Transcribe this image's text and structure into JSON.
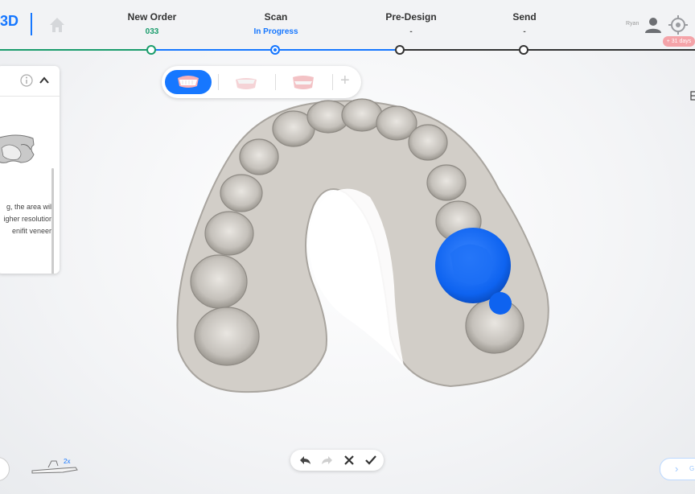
{
  "header": {
    "logo": "3D",
    "steps": [
      {
        "title": "New Order",
        "sub": "033",
        "state": "done"
      },
      {
        "title": "Scan",
        "sub": "In Progress",
        "state": "current"
      },
      {
        "title": "Pre-Design",
        "sub": "-",
        "state": "pending"
      },
      {
        "title": "Send",
        "sub": "-",
        "state": "pending"
      }
    ],
    "user_name": "Ryan",
    "days_badge": "+ 31 days"
  },
  "left_panel": {
    "text_lines": [
      "g, the area will",
      "igher resolution",
      "enifit veneer,"
    ]
  },
  "jaw_selector": {
    "options": [
      "upper-jaw",
      "lower-jaw",
      "bite"
    ],
    "selected": "upper-jaw",
    "add_label": "+"
  },
  "scanner": {
    "label": "2x"
  },
  "actions": [
    "undo",
    "redo",
    "cancel",
    "confirm"
  ],
  "next_button": {
    "label": "G"
  },
  "colors": {
    "accent": "#1677ff",
    "done_green": "#1a9c6c",
    "model_gray": "#cdc9c3",
    "highlight_blue": "#0e63f0",
    "badge_pink": "#f4a3a8"
  }
}
